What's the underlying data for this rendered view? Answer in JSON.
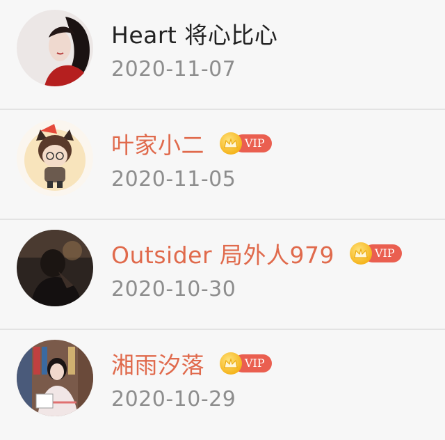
{
  "users": [
    {
      "name": "Heart 将心比心",
      "date": "2020-11-07",
      "vip": false
    },
    {
      "name": "叶家小二",
      "date": "2020-11-05",
      "vip": true,
      "vip_label": "VIP"
    },
    {
      "name": "Outsider 局外人979",
      "date": "2020-10-30",
      "vip": true,
      "vip_label": "VIP"
    },
    {
      "name": "湘雨汐落",
      "date": "2020-10-29",
      "vip": true,
      "vip_label": "VIP"
    }
  ],
  "colors": {
    "vip_name": "#e06a4c",
    "vip_badge": "#ea5f50",
    "crown": "#f5b51e",
    "date": "#8d8d8d"
  }
}
